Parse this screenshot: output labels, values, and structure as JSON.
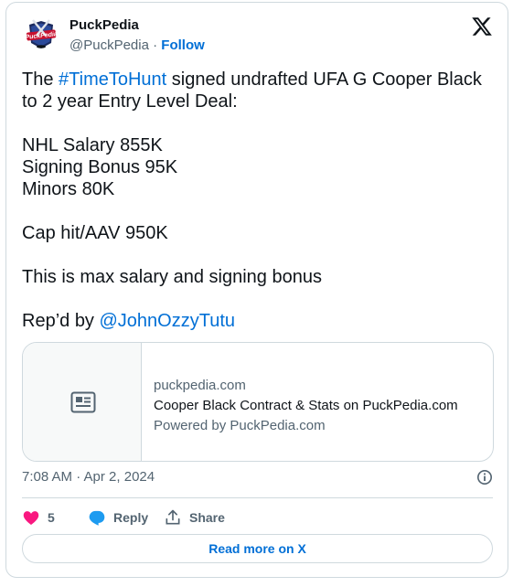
{
  "account": {
    "name": "PuckPedia",
    "handle": "@PuckPedia",
    "separator": "·",
    "follow_label": "Follow",
    "avatar_text": "PuckPedia"
  },
  "tweet": {
    "line1_prefix": "The ",
    "hashtag": "#TimeToHunt",
    "line1_suffix": " signed undrafted UFA G Cooper Black",
    "line2": "to 2 year Entry Level Deal:",
    "salary_lines": [
      "NHL Salary 855K",
      "Signing Bonus 95K",
      "Minors 80K"
    ],
    "cap_hit": "Cap hit/AAV 950K",
    "note": "This is max salary and signing bonus",
    "reported_prefix": "Rep’d by ",
    "reported_mention": "@JohnOzzyTutu"
  },
  "link_card": {
    "domain": "puckpedia.com",
    "title": "Cooper Black Contract & Stats on PuckPedia.com",
    "description": "Powered by PuckPedia.com",
    "icon": "article-icon"
  },
  "meta": {
    "timestamp": "7:08 AM · Apr 2, 2024"
  },
  "actions": {
    "like_count": "5",
    "reply_label": "Reply",
    "share_label": "Share"
  },
  "read_more_label": "Read more on X",
  "colors": {
    "link": "#006fd6",
    "like": "#f91880",
    "reply": "#1d9bf0",
    "muted": "#536471",
    "border": "#cfd9de"
  }
}
